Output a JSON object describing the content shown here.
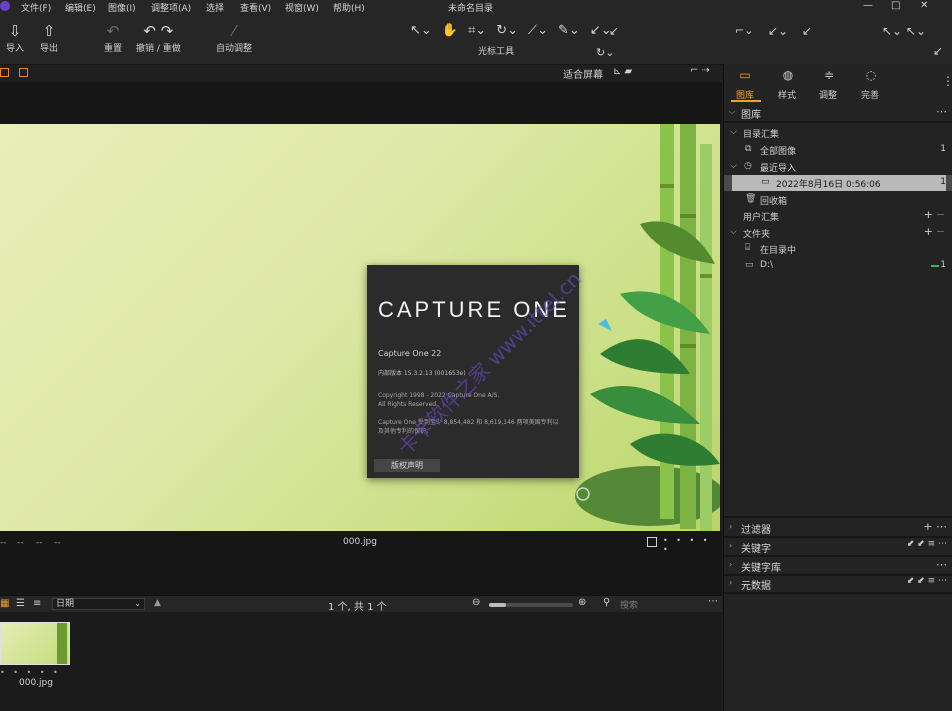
{
  "menubar": {
    "items": [
      "文件(F)",
      "编辑(E)",
      "图像(I)",
      "调整项(A)",
      "选择",
      "查看(V)",
      "视窗(W)",
      "帮助(H)"
    ],
    "title": "未命名目录",
    "controls": [
      "—",
      "□",
      "✕"
    ]
  },
  "toolbar": {
    "import": "导入",
    "export": "导出",
    "reset": "重置",
    "undo_redo": "撤销 / 重做",
    "auto_adjust": "自动调整",
    "cursor_tools_label": "光标工具"
  },
  "viewer": {
    "fit_label": "适合屏幕",
    "filename": "000.jpg",
    "dashes": [
      "--",
      "--",
      "--",
      "--"
    ],
    "dots": "• • • • •"
  },
  "splash": {
    "brand": "CAPTURE ONE",
    "version": "Capture One 22",
    "build": "内部版本 15.3.2.13 (001653e)",
    "copyright_line1": "Copyright 1998 - 2022 Capture One A/S.",
    "copyright_line2": "All Rights Reserved.",
    "patent_line1": "Capture One 受到至少 8,854,482 和 8,619,146 两项美国专利以",
    "patent_line2": "及其他专利的保护。",
    "button": "版权声明",
    "watermark": "卡卡软件之家 www.ittel.cn"
  },
  "browser": {
    "sort": "日期",
    "count": "1 个, 共 1 个",
    "search_placeholder": "搜索",
    "zoom_percent": 20,
    "thumb_name": "000.jpg",
    "thumb_dots": "• • • • •"
  },
  "panel": {
    "tabs": [
      "图库",
      "样式",
      "调整",
      "完善"
    ],
    "library": {
      "title": "图库",
      "catalog_header": "目录汇集",
      "all_images": "全部图像",
      "all_images_count": "1",
      "recent_imports": "最近导入",
      "recent_item": "2022年8月16日 0:56:06",
      "recent_item_count": "1",
      "trash": "回收箱",
      "user_collections": "用户汇集",
      "folders": "文件夹",
      "in_catalog": "在目录中",
      "drive": "D:\\",
      "drive_count": "1"
    },
    "collapsed_sections": [
      "过滤器",
      "关键字",
      "关键字库",
      "元数据"
    ]
  },
  "colors": {
    "accent": "#f0a030",
    "panel_bg": "#232323",
    "viewer_bg": "#161616",
    "splash_bg": "#2b2b2b",
    "indicator": "#2bc24a"
  }
}
